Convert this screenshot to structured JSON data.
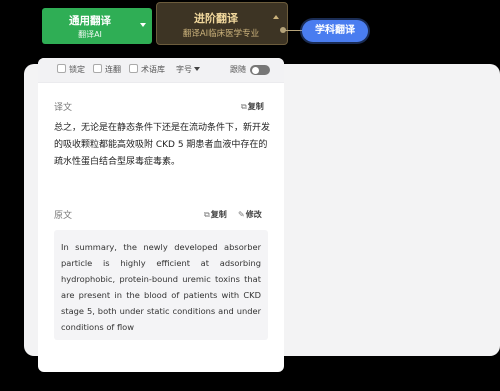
{
  "modes": {
    "general": {
      "title": "通用翻译",
      "subtitle": "翻译AI"
    },
    "advanced": {
      "title": "进阶翻译",
      "subtitle": "翻译AI临床医学专业"
    },
    "subject": {
      "label": "学科翻译"
    }
  },
  "toolbar": {
    "lock_label": "锁定",
    "link_label": "连翻",
    "glossary_label": "术语库",
    "fontsize_label": "字号",
    "follow_label": "跟随"
  },
  "translation": {
    "heading": "译文",
    "copy_label": "复制",
    "text": "总之，无论是在静态条件下还是在流动条件下，新开发的吸收颗粒都能高效吸附 CKD 5 期患者血液中存在的疏水性蛋白结合型尿毒症毒素。"
  },
  "source": {
    "heading": "原文",
    "copy_label": "复制",
    "edit_label": "修改",
    "text": "In summary, the newly developed absorber particle is highly efficient at adsorbing hydrophobic, protein-bound uremic toxins that are present in the blood of patients with CKD stage 5, both under static conditions and under conditions of flow"
  },
  "colors": {
    "general_green": "#2fae55",
    "advanced_brown": "#3d3424",
    "subject_blue": "#4a7df0"
  },
  "icons": [
    "chevron-down-icon",
    "chevron-up-icon",
    "copy-icon",
    "edit-icon",
    "checkbox-icon",
    "toggle-switch"
  ]
}
